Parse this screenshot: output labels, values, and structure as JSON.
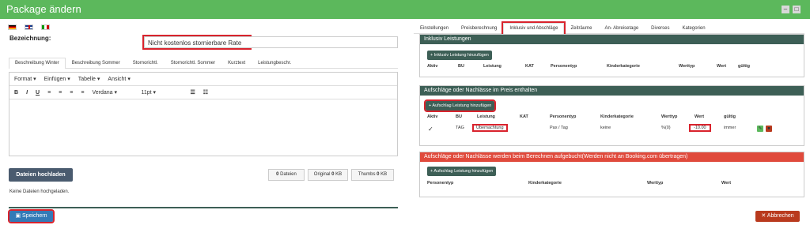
{
  "window": {
    "title": "Package ändern"
  },
  "form": {
    "label": "Bezeichnung:",
    "value": "Nicht kostenlos stornierbare Rate"
  },
  "left_tabs": [
    "Beschreibung Winter",
    "Beschreibung Sommer",
    "Stornorichtl.",
    "Stornorichtl. Sommer",
    "Kurztext",
    "Leistungbeschr."
  ],
  "editor": {
    "menu": [
      "Format",
      "Einfügen",
      "Tabelle",
      "Ansicht"
    ],
    "font": "Verdana",
    "size": "11pt"
  },
  "files": {
    "upload_label": "Dateien hochladen",
    "count_label": "Dateien",
    "count": "0",
    "original_label": "Original",
    "original_value": "0",
    "thumbs_label": "Thumbs",
    "thumbs_value": "0",
    "unit": "KB",
    "empty_text": "Keine Dateien hochgeladen."
  },
  "right_tabs": [
    "Einstellungen",
    "Preisberechnung",
    "Inklusiv und Abschläge",
    "Zeiträume",
    "An- Abreisetage",
    "Diverses",
    "Kategorien"
  ],
  "inclusive": {
    "header": "Inklusiv Leistungen",
    "button": "+ Inklusiv Leistung hinzufügen",
    "columns": [
      "Aktiv",
      "BU",
      "Leistung",
      "KAT",
      "Personentyp",
      "Kinderkategorie",
      "Werttyp",
      "Wert",
      "gültig"
    ]
  },
  "surcharges_in_price": {
    "header": "Aufschläge oder Nachlässe im Preis enthalten",
    "button": "+ Aufschlag Leistung hinzufügen",
    "columns": [
      "Aktiv",
      "BU",
      "Leistung",
      "KAT",
      "Personentyp",
      "Kinderkategorie",
      "Werttyp",
      "Wert",
      "gültig"
    ],
    "row": {
      "active": "✓",
      "bu": "TAG",
      "leistung": "Übernachtung",
      "kat": "",
      "personentyp": "Pax / Tag",
      "kinderkategorie": "keine",
      "werttyp": "%(0)",
      "wert": "-10.00",
      "gueltig": "immer"
    }
  },
  "surcharges_booked": {
    "header": "Aufschläge oder Nachlässe werden beim Berechnen aufgebucht(Werden nicht an Booking.com übertragen)",
    "button": "+ Aufschlag Leistung hinzufügen",
    "columns": [
      "Personentyp",
      "Kinderkategorie",
      "Werttyp",
      "Wert"
    ]
  },
  "footer": {
    "save": "Speichern",
    "cancel": "Abbrechen"
  },
  "colors": {
    "title_bar": "#5cb85c",
    "panel_header": "#3d5f56",
    "panel_header_red": "#e04a3c",
    "save": "#337ab7",
    "cancel": "#b93a1e",
    "highlight": "#d9232d"
  }
}
